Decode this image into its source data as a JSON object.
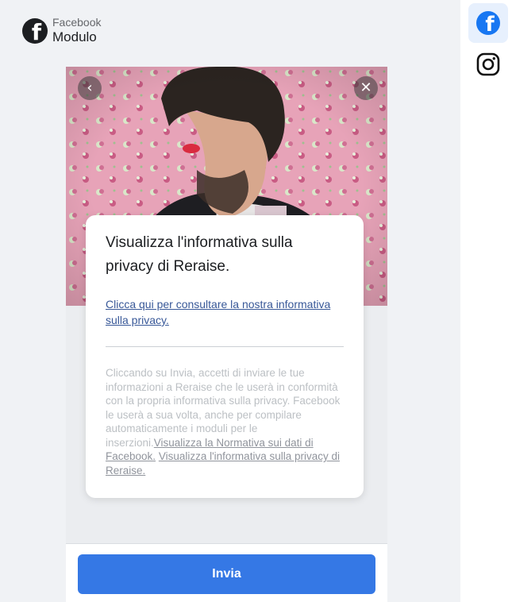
{
  "header": {
    "subtitle": "Facebook",
    "title": "Modulo",
    "logo_icon": "facebook-logo-icon"
  },
  "hero": {
    "back_icon": "chevron-left-icon",
    "close_icon": "close-icon",
    "back_glyph": "‹",
    "close_glyph": "✕"
  },
  "card": {
    "title": "Visualizza l'informativa sulla privacy di Reraise.",
    "link": "Clicca qui per consultare la nostra informativa sulla privacy.",
    "disclaimer_text": "Cliccando su Invia, accetti di inviare le tue informazioni a Reraise che le userà in conformità con la propria informativa sulla privacy. Facebook le userà a sua volta, anche per compilare automaticamente i moduli per le inserzioni.",
    "disclaimer_link_1": "Visualizza la Normativa sui dati di Facebook.",
    "disclaimer_link_2": "Visualizza l'informativa sulla privacy di Reraise."
  },
  "footer": {
    "submit_label": "Invia"
  },
  "sidebar": {
    "items": [
      {
        "icon": "facebook-icon",
        "active": true
      },
      {
        "icon": "instagram-icon",
        "active": false
      }
    ]
  },
  "colors": {
    "accent": "#3578e5",
    "facebook_blue": "#1877f2",
    "link": "#385898",
    "background": "#f0f2f5"
  }
}
